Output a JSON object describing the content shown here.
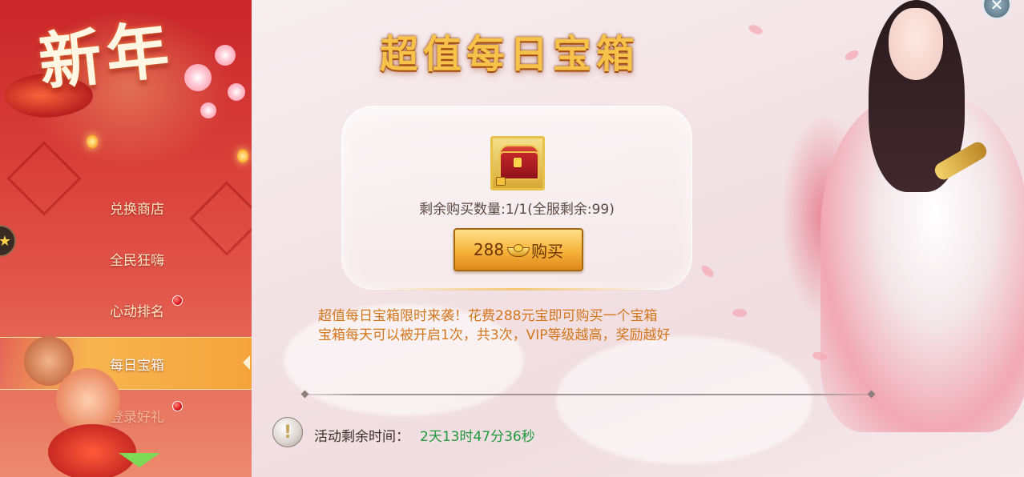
{
  "sidebar": {
    "banner_title": "新年",
    "items": [
      {
        "label": "兑换商店",
        "active": false,
        "has_dot": false
      },
      {
        "label": "全民狂嗨",
        "active": false,
        "has_dot": false
      },
      {
        "label": "心动排名",
        "active": false,
        "has_dot": true
      },
      {
        "label": "每日宝箱",
        "active": true,
        "has_dot": false
      },
      {
        "label": "登录好礼",
        "active": false,
        "has_dot": true
      }
    ]
  },
  "main": {
    "title": "超值每日宝箱",
    "remaining_text": "剩余购买数量:1/1(全服剩余:99)",
    "buy_button": {
      "price": "288",
      "label": "购买",
      "currency_icon": "gold-ingot-icon"
    },
    "description_lines": [
      "超值每日宝箱限时来袭！花费288元宝即可购买一个宝箱",
      "宝箱每天可以被开启1次，共3次，VIP等级越高，奖励越好"
    ],
    "timer": {
      "label": "活动剩余时间：",
      "value": "2天13时47分36秒"
    }
  },
  "colors": {
    "accent_gold": "#f6b23a",
    "sidebar_red": "#c9262a",
    "timer_green": "#1f9a3a",
    "desc_orange": "#d4761b"
  }
}
